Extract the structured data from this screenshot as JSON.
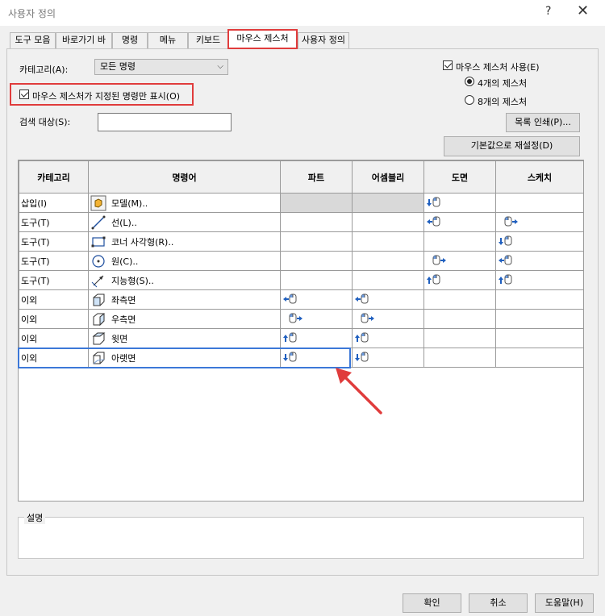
{
  "window": {
    "title": "사용자 정의",
    "help": "?",
    "close": "✕"
  },
  "tabs": [
    {
      "label": "도구 모음"
    },
    {
      "label": "바로가기 바"
    },
    {
      "label": "명령"
    },
    {
      "label": "메뉴"
    },
    {
      "label": "키보드"
    },
    {
      "label": "마우스 제스처",
      "active": true
    },
    {
      "label": "사용자 정의"
    }
  ],
  "filters": {
    "category_label": "카테고리(A):",
    "category_value": "모든 명령",
    "only_assigned_label": "마우스 제스처가 지정된 명령만 표시(O)",
    "search_label": "검색 대상(S):",
    "search_value": ""
  },
  "options": {
    "enable_label": "마우스 제스처 사용(E)",
    "radio_4": "4개의 제스처",
    "radio_8": "8개의 제스처",
    "print_button": "목록 인쇄(P)...",
    "reset_button": "기본값으로 재설정(D)"
  },
  "table": {
    "headers": [
      "카테고리",
      "명령어",
      "파트",
      "어셈블리",
      "도면",
      "스케치"
    ],
    "rows": [
      {
        "category": "삽입(I)",
        "icon": "model-icon",
        "command": "모델(M)..",
        "part": "",
        "assembly": "",
        "drawing": "down",
        "sketch": ""
      },
      {
        "category": "도구(T)",
        "icon": "line-icon",
        "command": "선(L)..",
        "part": "",
        "assembly": "",
        "drawing": "left",
        "sketch": "right"
      },
      {
        "category": "도구(T)",
        "icon": "corner-rectangle-icon",
        "command": "코너 사각형(R)..",
        "part": "",
        "assembly": "",
        "drawing": "",
        "sketch": "down"
      },
      {
        "category": "도구(T)",
        "icon": "circle-icon",
        "command": "원(C)..",
        "part": "",
        "assembly": "",
        "drawing": "right",
        "sketch": "left"
      },
      {
        "category": "도구(T)",
        "icon": "smart-dimension-icon",
        "command": "지능형(S)..",
        "part": "",
        "assembly": "",
        "drawing": "up",
        "sketch": "up"
      },
      {
        "category": "이외",
        "icon": "left-view-icon",
        "command": "좌측면",
        "part": "left",
        "assembly": "left",
        "drawing": "",
        "sketch": ""
      },
      {
        "category": "이외",
        "icon": "right-view-icon",
        "command": "우측면",
        "part": "right",
        "assembly": "right",
        "drawing": "",
        "sketch": ""
      },
      {
        "category": "이외",
        "icon": "back-view-icon",
        "command": "윗면",
        "part": "up",
        "assembly": "up",
        "drawing": "",
        "sketch": ""
      },
      {
        "category": "이외",
        "icon": "bottom-view-icon",
        "command": "아랫면",
        "part": "down",
        "assembly": "down",
        "drawing": "",
        "sketch": ""
      }
    ]
  },
  "description": {
    "label": "설명"
  },
  "footer": {
    "ok": "확인",
    "cancel": "취소",
    "help": "도움말(H)"
  },
  "colors": {
    "highlight_red": "#e03c3c",
    "selection_blue": "#3c78d8",
    "gesture_blue": "#1f5fbf"
  }
}
